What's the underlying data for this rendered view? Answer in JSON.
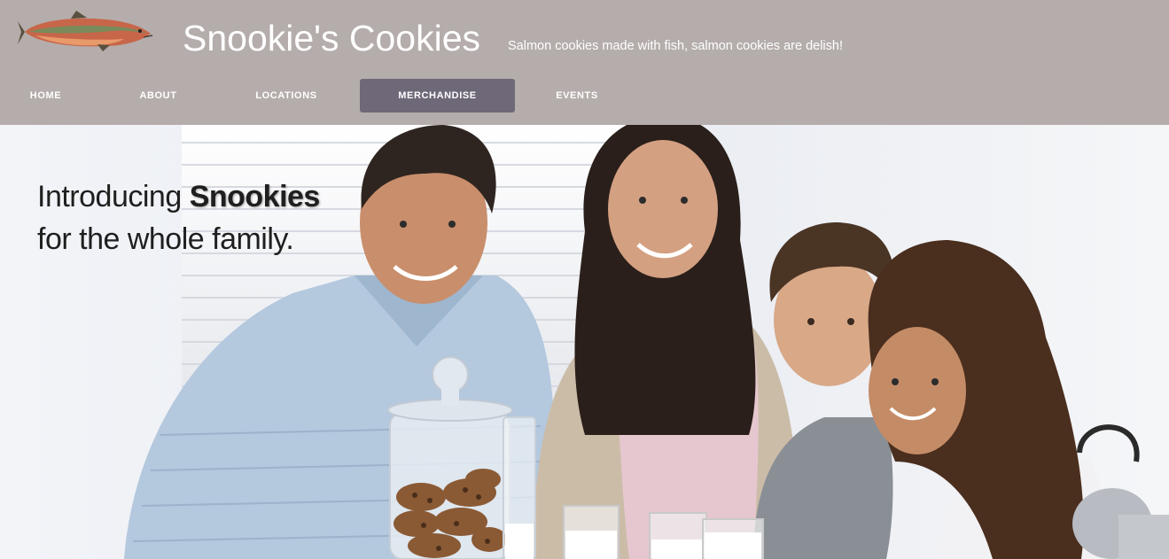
{
  "site": {
    "title": "Snookie's Cookies",
    "tagline": "Salmon cookies made with fish, salmon cookies are delish!",
    "logo_icon": "salmon-fish-icon"
  },
  "nav": {
    "items": [
      {
        "label": "HOME",
        "active": false
      },
      {
        "label": "ABOUT",
        "active": false
      },
      {
        "label": "LOCATIONS",
        "active": false
      },
      {
        "label": "MERCHANDISE",
        "active": true
      },
      {
        "label": "EVENTS",
        "active": false
      }
    ]
  },
  "hero": {
    "line1_prefix": "Introducing",
    "line1_bold": "Snookies",
    "line2": "for the whole family."
  },
  "colors": {
    "header_bg": "#b4adab",
    "nav_active_bg": "#6e6878",
    "text_white": "#ffffff"
  }
}
